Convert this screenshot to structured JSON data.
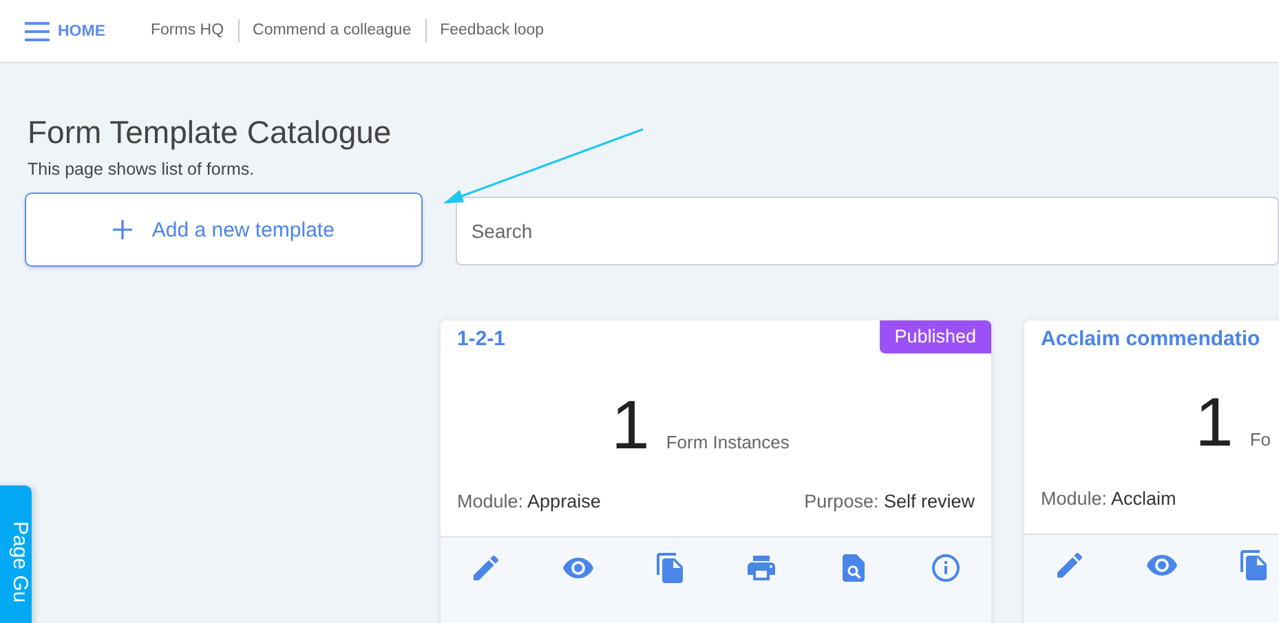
{
  "header": {
    "home": "HOME",
    "links": [
      "Forms HQ",
      "Commend a colleague",
      "Feedback loop"
    ]
  },
  "page": {
    "title": "Form Template Catalogue",
    "subtitle": "This page shows list of forms."
  },
  "add_button": "Add a new template",
  "search": {
    "placeholder": "Search"
  },
  "cards": [
    {
      "title": "1-2-1",
      "badge": "Published",
      "count": "1",
      "count_label": "Form Instances",
      "module_label": "Module:",
      "module": "Appraise",
      "purpose_label": "Purpose:",
      "purpose": "Self review",
      "actions": [
        {
          "kind": "edit"
        },
        {
          "kind": "view"
        },
        {
          "kind": "copy"
        },
        {
          "kind": "print"
        },
        {
          "kind": "preview"
        },
        {
          "kind": "info"
        }
      ]
    },
    {
      "title": "Acclaim commendatio",
      "count": "1",
      "count_label": "Fo",
      "module_label": "Module:",
      "module": "Acclaim",
      "actions": [
        {
          "kind": "edit"
        },
        {
          "kind": "view"
        },
        {
          "kind": "copy"
        }
      ]
    }
  ],
  "page_guide": "Page Gu"
}
